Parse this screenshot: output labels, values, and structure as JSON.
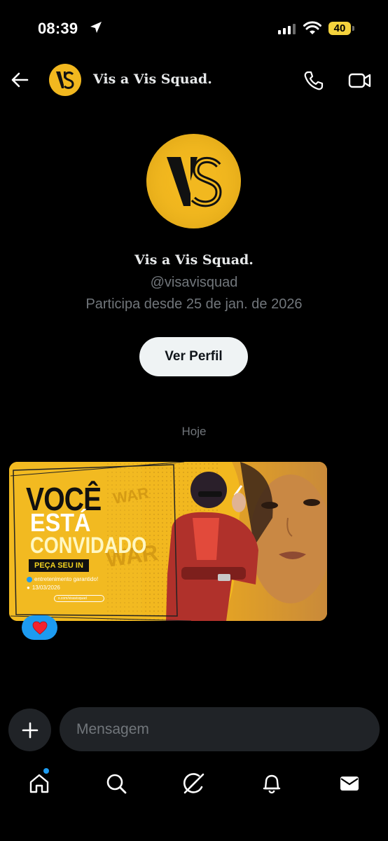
{
  "status_bar": {
    "time": "08:39",
    "battery": "40"
  },
  "header": {
    "title": "Vis a Vis Squad."
  },
  "profile": {
    "avatar_logo": "VS",
    "name": "Vis a Vis Squad.",
    "handle": "@visavisquad",
    "joined": "Participa desde 25 de jan. de 2026",
    "view_profile_label": "Ver Perfil"
  },
  "conversation": {
    "date_separator": "Hoje",
    "image": {
      "line1": "VOCÊ",
      "line2": "ESTÁ",
      "line3": "CONVIDADO",
      "cta": "PEÇA SEU IN",
      "tagline": "entretenimento garantido!",
      "date": "13/03/2026",
      "search_text": "x.com/visavisquad"
    },
    "reaction": "❤️"
  },
  "composer": {
    "placeholder": "Mensagem"
  },
  "nav": [
    "home-icon",
    "search-icon",
    "grok-icon",
    "notifications-icon",
    "messages-icon"
  ],
  "colors": {
    "accent": "#1d9bf0",
    "brand_yellow": "#f2b81f",
    "background": "#000000"
  }
}
